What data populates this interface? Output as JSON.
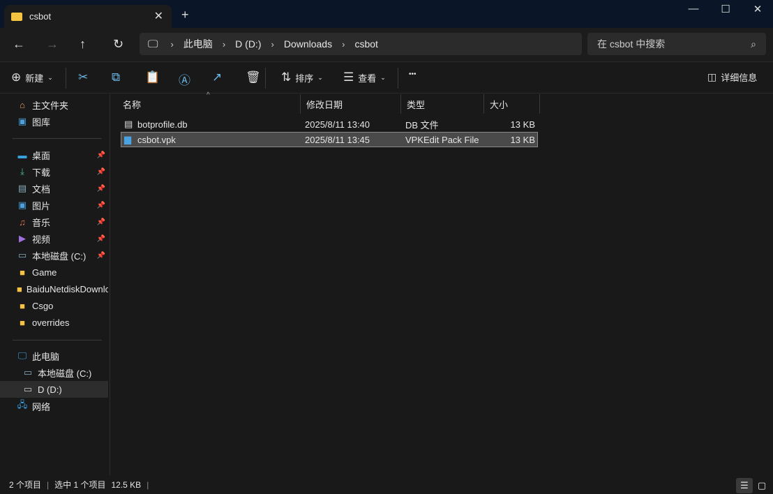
{
  "window": {
    "tab_title": "csbot",
    "new_tab": "+",
    "close_tab": "✕",
    "minimize": "—",
    "maximize": "☐",
    "close": "✕"
  },
  "nav": {
    "back": "←",
    "forward": "→",
    "up": "↑",
    "refresh": "↻",
    "breadcrumbs": [
      "此电脑",
      "D (D:)",
      "Downloads",
      "csbot"
    ],
    "search_placeholder": "在 csbot 中搜索"
  },
  "toolbar": {
    "new": "新建",
    "sort": "排序",
    "view": "查看",
    "more": "•••",
    "details": "详细信息"
  },
  "sidebar": {
    "quick": [
      {
        "label": "主文件夹",
        "icon": "home-icon"
      },
      {
        "label": "图库",
        "icon": "gallery-icon"
      }
    ],
    "pinned": [
      {
        "label": "桌面",
        "icon": "desktop-icon"
      },
      {
        "label": "下载",
        "icon": "download-icon"
      },
      {
        "label": "文档",
        "icon": "document-icon"
      },
      {
        "label": "图片",
        "icon": "pictures-icon"
      },
      {
        "label": "音乐",
        "icon": "music-icon"
      },
      {
        "label": "视频",
        "icon": "video-icon"
      },
      {
        "label": "本地磁盘 (C:)",
        "icon": "drive-icon"
      }
    ],
    "folders": [
      "Game",
      "BaiduNetdiskDownload",
      "Csgo",
      "overrides"
    ],
    "pc": {
      "label": "此电脑",
      "children": [
        "本地磁盘 (C:)",
        "D (D:)"
      ]
    },
    "network": "网络"
  },
  "columns": [
    "名称",
    "修改日期",
    "类型",
    "大小"
  ],
  "files": [
    {
      "name": "botprofile.db",
      "date": "2025/8/11 13:40",
      "type": "DB 文件",
      "size": "13 KB",
      "selected": false
    },
    {
      "name": "csbot.vpk",
      "date": "2025/8/11 13:45",
      "type": "VPKEdit Pack File",
      "size": "13 KB",
      "selected": true
    }
  ],
  "status": {
    "count": "2 个项目",
    "selected": "选中 1 个项目",
    "size": "12.5 KB"
  }
}
